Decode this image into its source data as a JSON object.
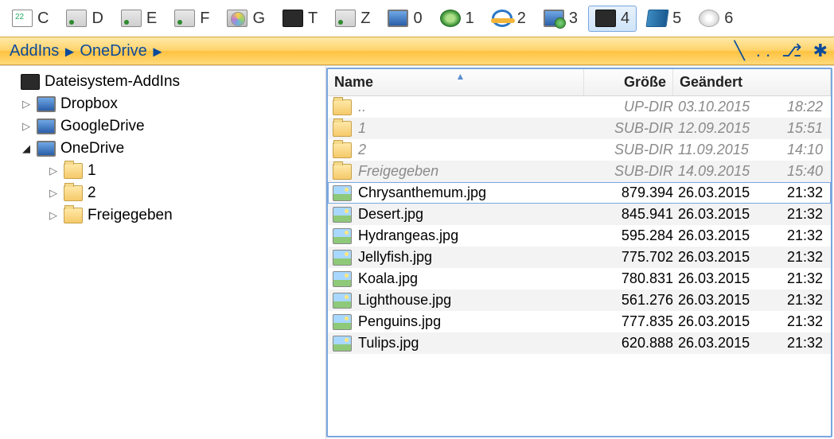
{
  "drives": [
    {
      "letter": "C",
      "icon": "calendar"
    },
    {
      "letter": "D",
      "icon": "hdd"
    },
    {
      "letter": "E",
      "icon": "hdd"
    },
    {
      "letter": "F",
      "icon": "hdd"
    },
    {
      "letter": "G",
      "icon": "dvd"
    },
    {
      "letter": "T",
      "icon": "chip"
    },
    {
      "letter": "Z",
      "icon": "hdd"
    },
    {
      "letter": "0",
      "icon": "monitor"
    },
    {
      "letter": "1",
      "icon": "globe"
    },
    {
      "letter": "2",
      "icon": "ie"
    },
    {
      "letter": "3",
      "icon": "monitor-net"
    },
    {
      "letter": "4",
      "icon": "chip",
      "active": true
    },
    {
      "letter": "5",
      "icon": "book"
    },
    {
      "letter": "6",
      "icon": "cd"
    }
  ],
  "breadcrumb": {
    "segments": [
      "AddIns",
      "OneDrive"
    ],
    "right_icons": [
      "line",
      "dots",
      "tree",
      "star"
    ]
  },
  "tree": {
    "root": {
      "label": "Dateisystem-AddIns",
      "icon": "chip",
      "expanded": true
    },
    "children": [
      {
        "label": "Dropbox",
        "icon": "monitor",
        "expanded": false,
        "depth": 1
      },
      {
        "label": "GoogleDrive",
        "icon": "monitor",
        "expanded": false,
        "depth": 1
      },
      {
        "label": "OneDrive",
        "icon": "monitor",
        "expanded": true,
        "depth": 1
      },
      {
        "label": "1",
        "icon": "folder",
        "expanded": false,
        "depth": 2
      },
      {
        "label": "2",
        "icon": "folder",
        "expanded": false,
        "depth": 2
      },
      {
        "label": "Freigegeben",
        "icon": "folder",
        "expanded": false,
        "depth": 2
      }
    ]
  },
  "list": {
    "columns": {
      "name": "Name",
      "size": "Größe",
      "modified": "Geändert"
    },
    "rows": [
      {
        "name": "..",
        "size": "UP-DIR",
        "date": "03.10.2015",
        "time": "18:22",
        "type": "dir"
      },
      {
        "name": "1",
        "size": "SUB-DIR",
        "date": "12.09.2015",
        "time": "15:51",
        "type": "dir"
      },
      {
        "name": "2",
        "size": "SUB-DIR",
        "date": "11.09.2015",
        "time": "14:10",
        "type": "dir"
      },
      {
        "name": "Freigegeben",
        "size": "SUB-DIR",
        "date": "14.09.2015",
        "time": "15:40",
        "type": "dir"
      },
      {
        "name": "Chrysanthemum.jpg",
        "size": "879.394",
        "date": "26.03.2015",
        "time": "21:32",
        "type": "image",
        "selected": true
      },
      {
        "name": "Desert.jpg",
        "size": "845.941",
        "date": "26.03.2015",
        "time": "21:32",
        "type": "image"
      },
      {
        "name": "Hydrangeas.jpg",
        "size": "595.284",
        "date": "26.03.2015",
        "time": "21:32",
        "type": "image"
      },
      {
        "name": "Jellyfish.jpg",
        "size": "775.702",
        "date": "26.03.2015",
        "time": "21:32",
        "type": "image"
      },
      {
        "name": "Koala.jpg",
        "size": "780.831",
        "date": "26.03.2015",
        "time": "21:32",
        "type": "image"
      },
      {
        "name": "Lighthouse.jpg",
        "size": "561.276",
        "date": "26.03.2015",
        "time": "21:32",
        "type": "image"
      },
      {
        "name": "Penguins.jpg",
        "size": "777.835",
        "date": "26.03.2015",
        "time": "21:32",
        "type": "image"
      },
      {
        "name": "Tulips.jpg",
        "size": "620.888",
        "date": "26.03.2015",
        "time": "21:32",
        "type": "image"
      }
    ]
  }
}
